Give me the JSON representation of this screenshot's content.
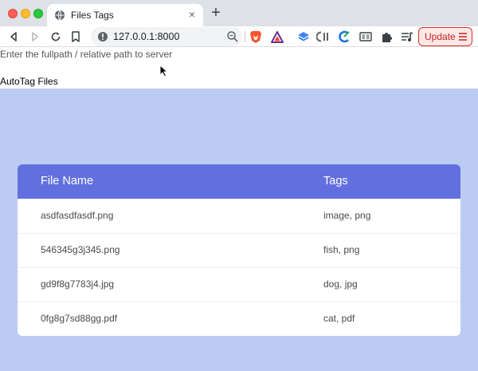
{
  "browser": {
    "tab_title": "Files Tags",
    "tab_close": "×",
    "new_tab": "+",
    "url": "127.0.0.1:8000",
    "update_label": "Update"
  },
  "page": {
    "path_label": "Enter the fullpath / relative path to server",
    "autotag_label": "AutoTag Files",
    "table": {
      "headers": {
        "name": "File Name",
        "tags": "Tags"
      },
      "rows": [
        {
          "name": "asdfasdfasdf.png",
          "tags": "image, png"
        },
        {
          "name": "546345g3j345.png",
          "tags": "fish, png"
        },
        {
          "name": "gd9f8g7783j4.jpg",
          "tags": "dog, jpg"
        },
        {
          "name": "0fg8g7sd88gg.pdf",
          "tags": "cat, pdf"
        }
      ]
    }
  },
  "colors": {
    "header_bg": "#6270df",
    "panel_bg": "#bccbf2",
    "update_accent": "#d93025"
  }
}
